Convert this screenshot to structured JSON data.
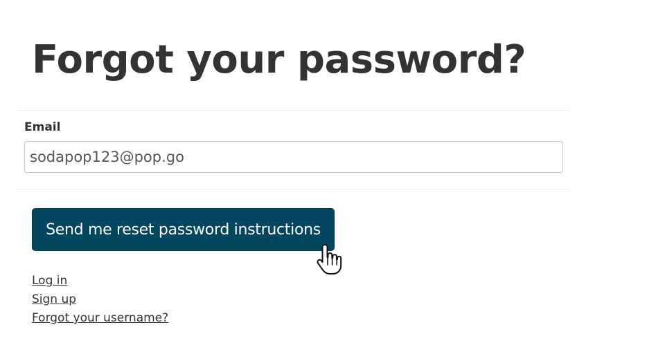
{
  "page": {
    "title": "Forgot your password?"
  },
  "form": {
    "email_label": "Email",
    "email_value": "sodapop123@pop.go",
    "submit_label": "Send me reset password instructions"
  },
  "links": [
    {
      "label": "Log in"
    },
    {
      "label": "Sign up"
    },
    {
      "label": "Forgot your username?"
    }
  ],
  "colors": {
    "button_background": "#034660",
    "text": "#333333"
  },
  "cursor": {
    "icon": "pointer-hand-icon"
  }
}
